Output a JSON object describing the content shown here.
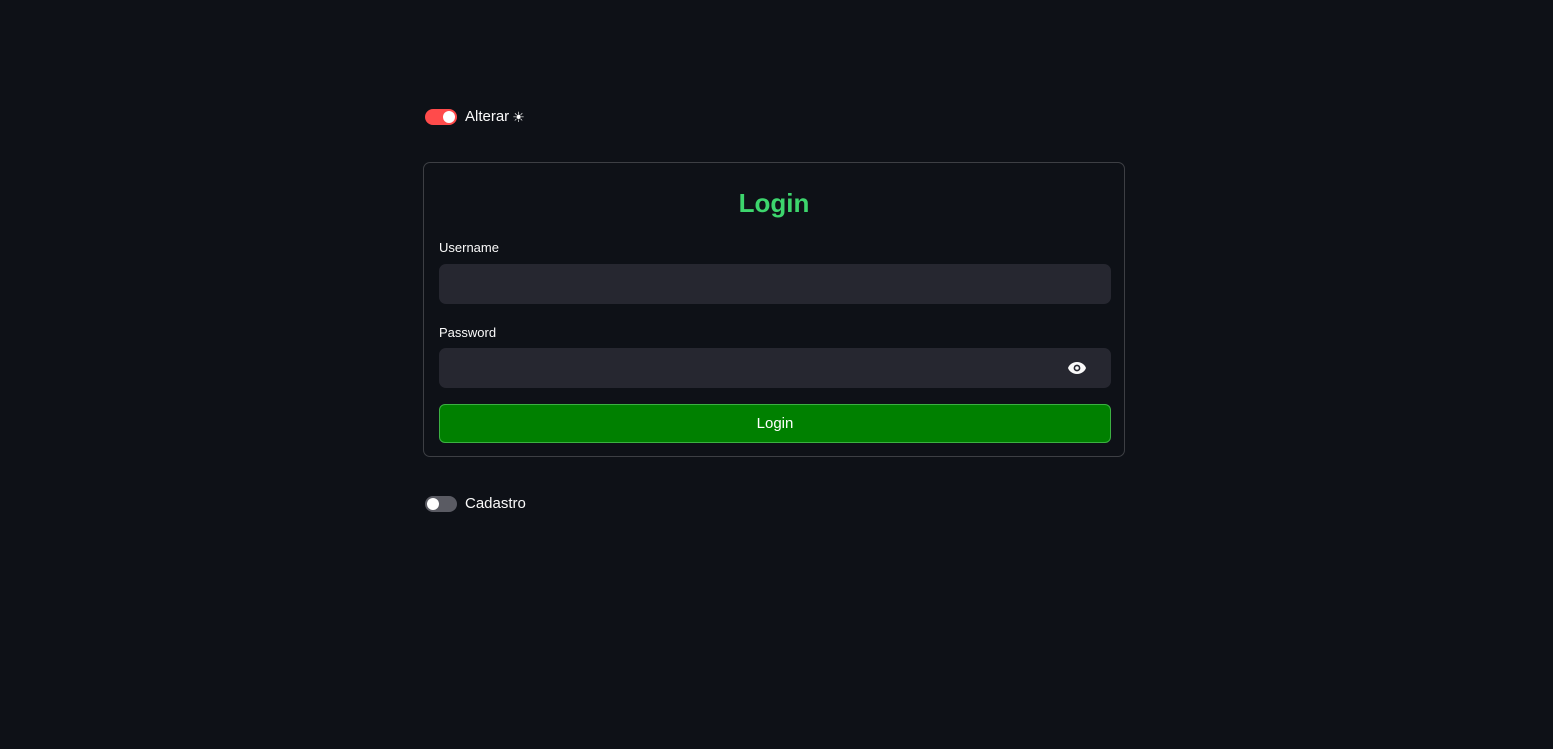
{
  "theme_toggle": {
    "label": "Alterar",
    "icon": "☀",
    "icon_name": "sun-icon",
    "checked": true,
    "on_color": "#ff4b4b"
  },
  "login_form": {
    "title": "Login",
    "title_color": "#3dd56d",
    "username": {
      "label": "Username",
      "value": "",
      "placeholder": ""
    },
    "password": {
      "label": "Password",
      "value": "",
      "placeholder": "",
      "icon_name": "eye-icon"
    },
    "submit": {
      "label": "Login",
      "color": "#008000"
    }
  },
  "signup_toggle": {
    "label": "Cadastro",
    "checked": false,
    "off_color": "#5a5b63"
  },
  "colors": {
    "background": "#0e1117",
    "input_background": "#262730",
    "text": "#fafafa"
  }
}
